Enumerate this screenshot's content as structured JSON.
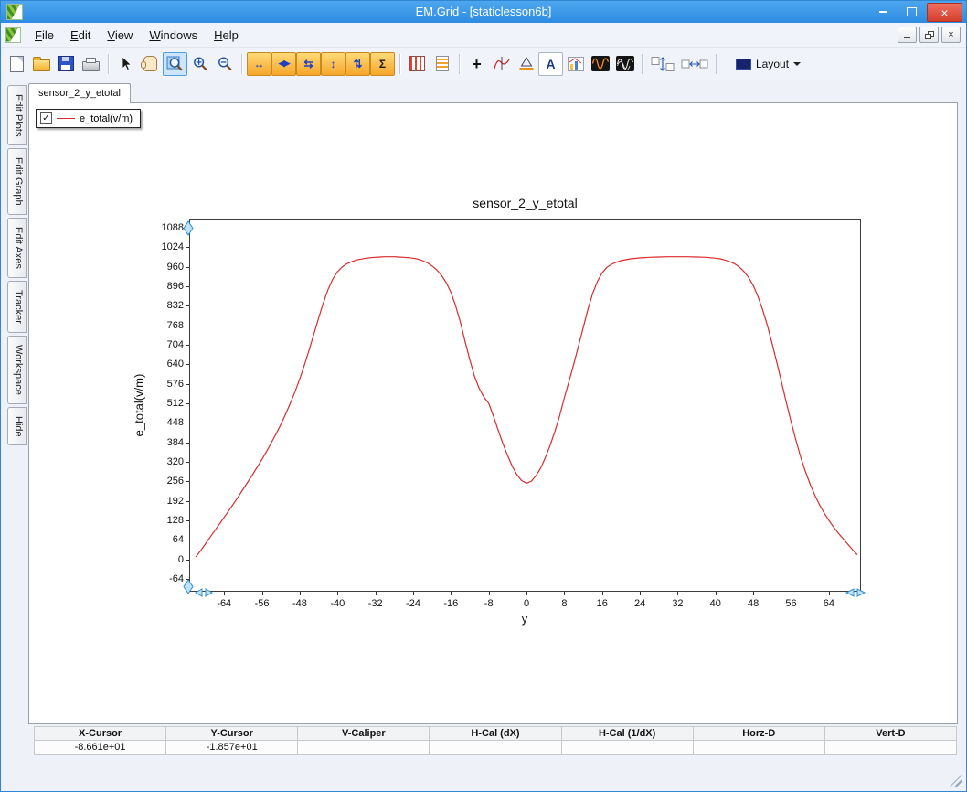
{
  "window": {
    "title": "EM.Grid - [staticlesson6b]",
    "close_glyph": "×"
  },
  "menubar": {
    "items": [
      "File",
      "Edit",
      "View",
      "Windows",
      "Help"
    ]
  },
  "toolbar": {
    "layout_label": "Layout",
    "buttons": [
      {
        "name": "new-file-button",
        "kind": "page"
      },
      {
        "name": "open-file-button",
        "kind": "folder"
      },
      {
        "name": "save-button",
        "kind": "floppy"
      },
      {
        "name": "print-button",
        "kind": "printer"
      },
      {
        "kind": "sep"
      },
      {
        "name": "select-pointer-button",
        "kind": "pointer"
      },
      {
        "name": "pan-hand-button",
        "kind": "hand"
      },
      {
        "name": "zoom-window-button",
        "kind": "zoom",
        "active": true
      },
      {
        "name": "zoom-in-button",
        "kind": "zoom-in"
      },
      {
        "name": "zoom-out-button",
        "kind": "zoom-out"
      },
      {
        "kind": "sep"
      },
      {
        "name": "expand-horizontal-button",
        "kind": "glyph",
        "glyph": "↔",
        "style": "orange"
      },
      {
        "name": "shift-horizontal-button",
        "kind": "glyph",
        "glyph": "◀▶",
        "style": "orange"
      },
      {
        "name": "fit-horizontal-button",
        "kind": "glyph",
        "glyph": "⇆",
        "style": "orange"
      },
      {
        "name": "expand-vertical-button",
        "kind": "glyph",
        "glyph": "↕",
        "style": "orange"
      },
      {
        "name": "shift-vertical-button",
        "kind": "glyph",
        "glyph": "⇅",
        "style": "orange"
      },
      {
        "name": "autoscale-vertical-button",
        "kind": "glyph",
        "glyph": "Σ",
        "style": "orange-dark"
      },
      {
        "kind": "sep"
      },
      {
        "name": "data-columns-button",
        "kind": "stripes"
      },
      {
        "name": "data-sheet-button",
        "kind": "sheet"
      },
      {
        "kind": "sep"
      },
      {
        "name": "cross-marker-button",
        "kind": "glyph",
        "glyph": "+",
        "style": "plain"
      },
      {
        "name": "tracker-tool-button",
        "kind": "tracker"
      },
      {
        "name": "caliper-tool-button",
        "kind": "caliper"
      },
      {
        "name": "text-annotation-button",
        "kind": "glyph",
        "glyph": "A",
        "style": "letter"
      },
      {
        "name": "insert-graph-button",
        "kind": "minichart"
      },
      {
        "name": "fft-view-button",
        "kind": "sine-orange"
      },
      {
        "name": "waveform-view-button",
        "kind": "sine-white"
      },
      {
        "kind": "sep"
      },
      {
        "name": "vertical-markers-button",
        "kind": "caliper-v"
      },
      {
        "name": "horizontal-markers-button",
        "kind": "caliper-h"
      },
      {
        "kind": "sep"
      }
    ]
  },
  "sidebar": {
    "tabs": [
      "Edit Plots",
      "Edit Graph",
      "Edit Axes",
      "Tracker",
      "Workspace",
      "Hide"
    ]
  },
  "document": {
    "tab_label": "sensor_2_y_etotal"
  },
  "legend": {
    "label": "e_total(v/m)",
    "checked": true,
    "line_color": "#d92b2b"
  },
  "chart_data": {
    "type": "line",
    "title": "sensor_2_y_etotal",
    "xlabel": "y",
    "ylabel": "e_total(v/m)",
    "xlim": [
      -71.4,
      70.8
    ],
    "ylim": [
      -106,
      1115
    ],
    "grid": false,
    "legend_position": "floating-top-left",
    "x_ticks": [
      -64,
      -56,
      -48,
      -40,
      -32,
      -24,
      -16,
      -8,
      0,
      8,
      16,
      24,
      32,
      40,
      48,
      56,
      64
    ],
    "y_ticks": [
      1088,
      1024,
      960,
      896,
      832,
      768,
      704,
      640,
      576,
      512,
      448,
      384,
      320,
      256,
      192,
      128,
      64,
      0,
      -64
    ],
    "series": [
      {
        "name": "e_total(v/m)",
        "color": "#d92b2b",
        "points": [
          [
            -70,
            8
          ],
          [
            -69,
            28
          ],
          [
            -68,
            50
          ],
          [
            -67,
            72
          ],
          [
            -66,
            94
          ],
          [
            -65,
            116
          ],
          [
            -64,
            138
          ],
          [
            -63,
            160
          ],
          [
            -62,
            183
          ],
          [
            -61,
            206
          ],
          [
            -60,
            230
          ],
          [
            -59,
            254
          ],
          [
            -58,
            278
          ],
          [
            -57,
            303
          ],
          [
            -56,
            328
          ],
          [
            -55,
            355
          ],
          [
            -54,
            383
          ],
          [
            -53,
            412
          ],
          [
            -52,
            443
          ],
          [
            -51,
            476
          ],
          [
            -50,
            512
          ],
          [
            -49,
            550
          ],
          [
            -48,
            592
          ],
          [
            -47,
            638
          ],
          [
            -46,
            688
          ],
          [
            -45,
            740
          ],
          [
            -44,
            792
          ],
          [
            -43,
            842
          ],
          [
            -42,
            886
          ],
          [
            -41,
            920
          ],
          [
            -40,
            944
          ],
          [
            -39,
            960
          ],
          [
            -38,
            970
          ],
          [
            -37,
            977
          ],
          [
            -36,
            982
          ],
          [
            -35,
            985
          ],
          [
            -34,
            988
          ],
          [
            -33,
            990
          ],
          [
            -32,
            991
          ],
          [
            -31,
            992
          ],
          [
            -30,
            993
          ],
          [
            -29,
            993
          ],
          [
            -28,
            993
          ],
          [
            -27,
            992
          ],
          [
            -26,
            991
          ],
          [
            -25,
            990
          ],
          [
            -24,
            988
          ],
          [
            -23,
            985
          ],
          [
            -22,
            980
          ],
          [
            -21,
            973
          ],
          [
            -20,
            963
          ],
          [
            -19,
            950
          ],
          [
            -18,
            932
          ],
          [
            -17,
            908
          ],
          [
            -16,
            876
          ],
          [
            -15,
            832
          ],
          [
            -14,
            778
          ],
          [
            -13,
            714
          ],
          [
            -12,
            655
          ],
          [
            -11,
            600
          ],
          [
            -10,
            560
          ],
          [
            -9,
            532
          ],
          [
            -8,
            512
          ],
          [
            -7,
            470
          ],
          [
            -6,
            424
          ],
          [
            -5,
            380
          ],
          [
            -4,
            340
          ],
          [
            -3,
            305
          ],
          [
            -2,
            277
          ],
          [
            -1,
            258
          ],
          [
            0,
            250
          ],
          [
            1,
            256
          ],
          [
            2,
            274
          ],
          [
            3,
            300
          ],
          [
            4,
            334
          ],
          [
            5,
            374
          ],
          [
            6,
            420
          ],
          [
            7,
            470
          ],
          [
            8,
            530
          ],
          [
            9,
            585
          ],
          [
            10,
            640
          ],
          [
            11,
            700
          ],
          [
            12,
            760
          ],
          [
            13,
            820
          ],
          [
            14,
            872
          ],
          [
            15,
            912
          ],
          [
            16,
            940
          ],
          [
            17,
            958
          ],
          [
            18,
            968
          ],
          [
            19,
            975
          ],
          [
            20,
            980
          ],
          [
            22,
            986
          ],
          [
            24,
            989
          ],
          [
            26,
            991
          ],
          [
            28,
            992
          ],
          [
            30,
            993
          ],
          [
            32,
            993
          ],
          [
            34,
            993
          ],
          [
            36,
            992
          ],
          [
            38,
            991
          ],
          [
            40,
            988
          ],
          [
            41,
            986
          ],
          [
            42,
            982
          ],
          [
            43,
            977
          ],
          [
            44,
            970
          ],
          [
            45,
            960
          ],
          [
            46,
            945
          ],
          [
            47,
            925
          ],
          [
            48,
            898
          ],
          [
            49,
            862
          ],
          [
            50,
            818
          ],
          [
            51,
            766
          ],
          [
            52,
            708
          ],
          [
            53,
            645
          ],
          [
            54,
            580
          ],
          [
            55,
            515
          ],
          [
            56,
            452
          ],
          [
            57,
            392
          ],
          [
            58,
            338
          ],
          [
            59,
            290
          ],
          [
            60,
            248
          ],
          [
            61,
            212
          ],
          [
            62,
            180
          ],
          [
            63,
            152
          ],
          [
            64,
            128
          ],
          [
            65,
            106
          ],
          [
            66,
            86
          ],
          [
            67,
            68
          ],
          [
            68,
            50
          ],
          [
            69,
            32
          ],
          [
            70,
            15
          ]
        ]
      }
    ]
  },
  "statusbar": {
    "headers": [
      "X-Cursor",
      "Y-Cursor",
      "V-Caliper",
      "H-Cal (dX)",
      "H-Cal (1/dX)",
      "Horz-D",
      "Vert-D"
    ],
    "values": [
      "-8.661e+01",
      "-1.857e+01",
      "",
      "",
      "",
      "",
      ""
    ]
  }
}
